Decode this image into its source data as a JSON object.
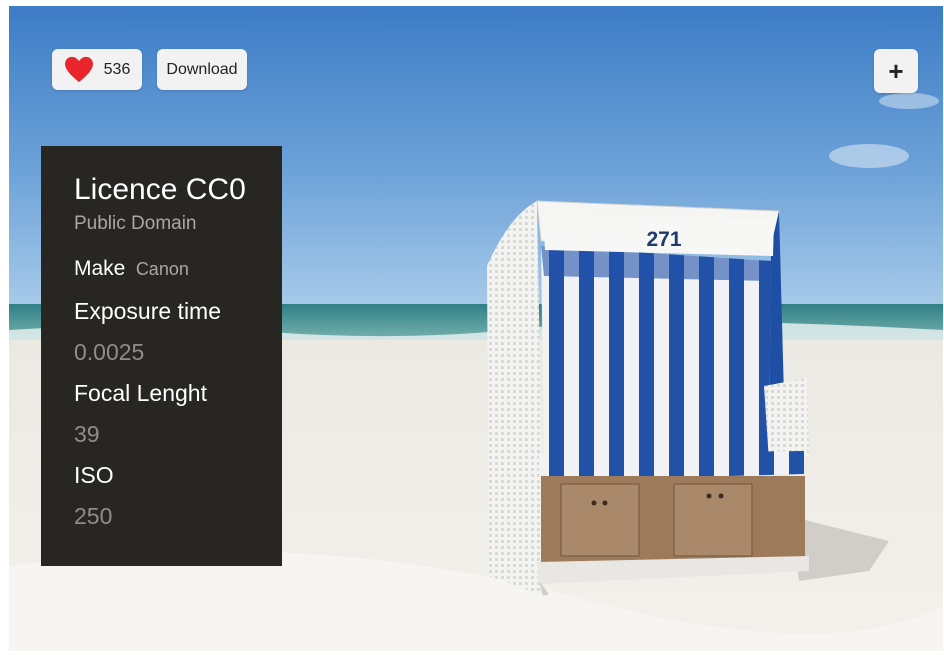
{
  "toolbar": {
    "like_icon": "heart-icon",
    "like_color": "#e8262b",
    "like_count": "536",
    "download_label": "Download",
    "add_label": "+"
  },
  "photo": {
    "chair_number": "271"
  },
  "info": {
    "licence_title": "Licence CC0",
    "licence_sub": "Public Domain",
    "make_label": "Make",
    "make_value": "Canon",
    "exposure_label": "Exposure time",
    "exposure_value": "0.0025",
    "focal_label": "Focal Lenght",
    "focal_value": "39",
    "iso_label": "ISO",
    "iso_value": "250"
  }
}
